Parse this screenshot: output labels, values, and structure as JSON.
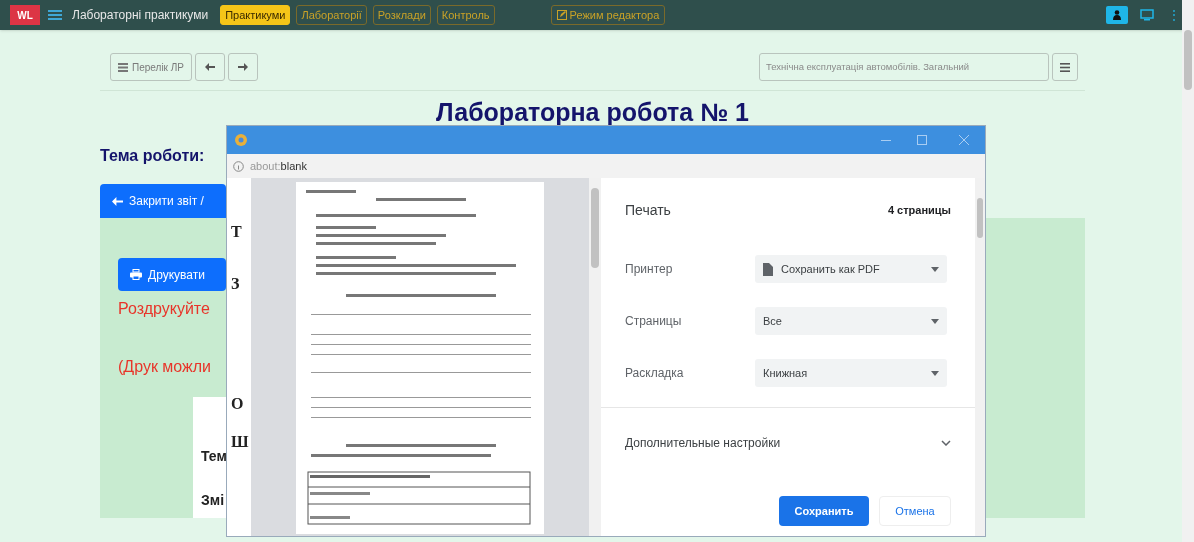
{
  "navbar": {
    "logo": "WL",
    "title": "Лабораторні практикуми",
    "tabs": [
      {
        "label": "Практикуми",
        "selected": true
      },
      {
        "label": "Лабораторії",
        "selected": false
      },
      {
        "label": "Розклади",
        "selected": false
      },
      {
        "label": "Контроль",
        "selected": false
      }
    ],
    "editor_button": "Режим редактора",
    "overflow_menu": "⋮"
  },
  "toolbar": {
    "list_button": "Перелік ЛР",
    "course_select": "Технічна експлуатація автомобілів. Загальний"
  },
  "page": {
    "heading": "Лабораторна робота № 1",
    "topic_label": "Тема роботи:",
    "close_button": "Закрити звіт /",
    "print_button": "Друкувати",
    "notes": [
      "Роздрукуйте",
      "(Друк можли"
    ],
    "card_texts": [
      "Тем",
      "Змі"
    ]
  },
  "print_window": {
    "address_prefix": "about:",
    "address": "blank",
    "fragments": [
      "Т",
      "З",
      "О",
      "Ш"
    ],
    "title": "Печать",
    "page_count": "4 страницы",
    "settings": [
      {
        "label": "Принтер",
        "value": "Сохранить как PDF",
        "kind": "file"
      },
      {
        "label": "Страницы",
        "value": "Все",
        "kind": "plain"
      },
      {
        "label": "Раскладка",
        "value": "Книжная",
        "kind": "plain"
      }
    ],
    "more_settings": "Дополнительные настройки",
    "save_button": "Сохранить",
    "cancel_button": "Отмена"
  }
}
